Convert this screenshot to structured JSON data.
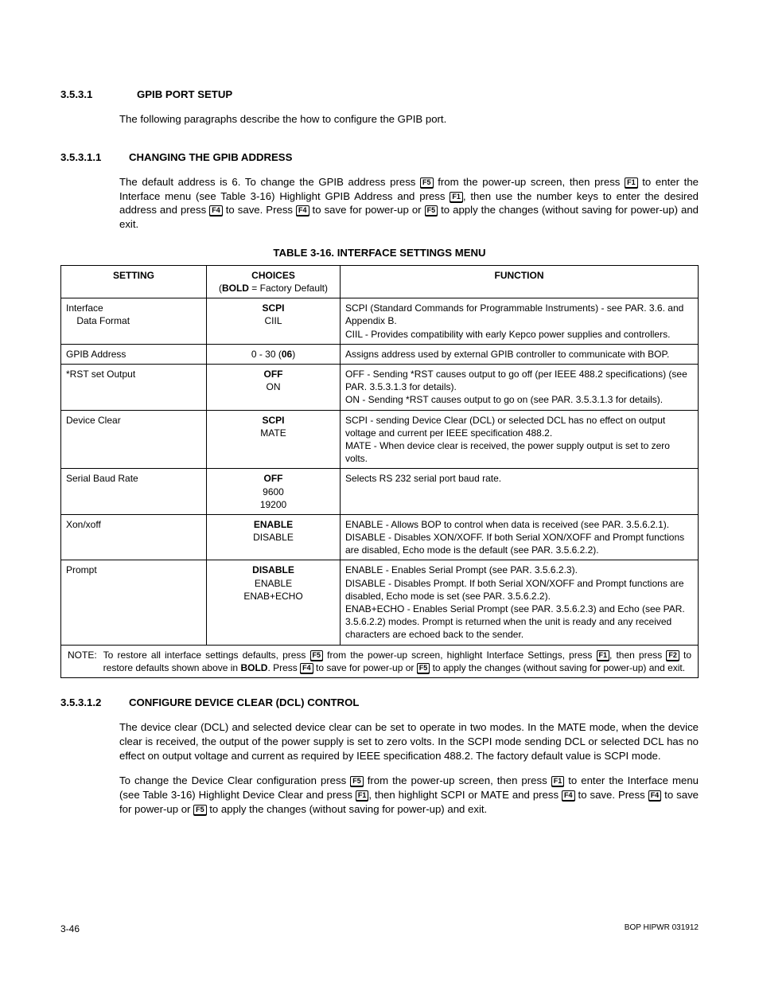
{
  "sections": {
    "s1_num": "3.5.3.1",
    "s1_title": "GPIB PORT SETUP",
    "s1_para": "The following paragraphs describe the how to configure the GPIB port.",
    "s11_num": "3.5.3.1.1",
    "s11_title": "CHANGING THE GPIB ADDRESS",
    "s11_para_a": "The default address is 6. To change the GPIB address press ",
    "s11_para_b": " from the power-up screen, then press ",
    "s11_para_c": " to enter the Interface menu (see Table 3-16) Highlight GPIB Address and press ",
    "s11_para_d": ", then use the number keys to enter the desired address and press ",
    "s11_para_e": " to save. Press ",
    "s11_para_f": " to save for power-up or ",
    "s11_para_g": " to apply the changes (without saving for power-up) and exit.",
    "s12_num": "3.5.3.1.2",
    "s12_title": "CONFIGURE DEVICE CLEAR (DCL) CONTROL",
    "s12_p1": "The device clear (DCL) and selected device clear can be set to operate in two modes. In the MATE mode, when the device clear is received, the output of the power supply is set to zero volts. In the SCPI mode sending DCL or selected DCL has no effect on output voltage and current as required by IEEE specification 488.2. The factory default value is SCPI mode.",
    "s12_p2_a": "To change the Device Clear configuration press ",
    "s12_p2_b": " from the power-up screen, then press ",
    "s12_p2_c": " to enter the Interface menu (see Table 3-16) Highlight Device Clear and press ",
    "s12_p2_d": ", then highlight SCPI or MATE and press ",
    "s12_p2_e": " to save. Press ",
    "s12_p2_f": " to save for power-up or ",
    "s12_p2_g": " to apply the changes (without saving for power-up) and exit."
  },
  "table": {
    "caption": "TABLE 3-16.  INTERFACE SETTINGS MENU",
    "headers": {
      "setting": "SETTING",
      "choices_l1": "CHOICES",
      "choices_l2a": "(",
      "choices_l2b": "BOLD",
      "choices_l2c": " = Factory Default)",
      "function": "FUNCTION"
    },
    "rows": [
      {
        "setting_l1": "Interface",
        "setting_l2": "    Data Format",
        "choices": [
          {
            "t": "SCPI",
            "b": true
          },
          {
            "t": "CIIL",
            "b": false
          }
        ],
        "function": "SCPI (Standard Commands for Programmable Instruments) - see PAR. 3.6. and Appendix B.\nCIIL - Provides compatibility with early Kepco power supplies and controllers."
      },
      {
        "setting_l1": "GPIB Address",
        "choices_inline": {
          "pre": "0 - 30 (",
          "bold": "06",
          "post": ")"
        },
        "function": "Assigns address used by external GPIB controller to communicate with BOP."
      },
      {
        "setting_l1": "*RST set Output",
        "choices": [
          {
            "t": "OFF",
            "b": true
          },
          {
            "t": "ON",
            "b": false
          }
        ],
        "function": "OFF - Sending *RST causes output to go off (per IEEE 488.2 specifications) (see PAR. 3.5.3.1.3 for details).\nON - Sending *RST causes output to go on (see PAR. 3.5.3.1.3 for details)."
      },
      {
        "setting_l1": "Device Clear",
        "choices": [
          {
            "t": "SCPI",
            "b": true
          },
          {
            "t": "MATE",
            "b": false
          }
        ],
        "function": "SCPI - sending Device Clear (DCL) or selected DCL has no effect on output voltage and current per IEEE specification 488.2.\nMATE - When device clear is received, the power supply output is set to zero volts."
      },
      {
        "setting_l1": "Serial Baud Rate",
        "choices": [
          {
            "t": "OFF",
            "b": true
          },
          {
            "t": "9600",
            "b": false
          },
          {
            "t": "19200",
            "b": false
          }
        ],
        "function": "Selects RS 232 serial port baud rate."
      },
      {
        "setting_l1": "Xon/xoff",
        "choices": [
          {
            "t": "ENABLE",
            "b": true
          },
          {
            "t": "DISABLE",
            "b": false
          }
        ],
        "function": "ENABLE - Allows BOP to control when data is received (see PAR. 3.5.6.2.1).\nDISABLE - Disables XON/XOFF. If both Serial XON/XOFF and Prompt functions are disabled, Echo mode is the default (see PAR. 3.5.6.2.2)."
      },
      {
        "setting_l1": "Prompt",
        "choices": [
          {
            "t": "DISABLE",
            "b": true
          },
          {
            "t": "ENABLE",
            "b": false
          },
          {
            "t": "ENAB+ECHO",
            "b": false
          }
        ],
        "function": "ENABLE - Enables Serial Prompt (see PAR. 3.5.6.2.3).\nDISABLE - Disables Prompt. If both Serial XON/XOFF and Prompt functions are disabled, Echo mode is set (see PAR. 3.5.6.2.2).\nENAB+ECHO - Enables Serial Prompt (see PAR. 3.5.6.2.3) and Echo (see PAR. 3.5.6.2.2) modes. Prompt is returned when the unit is ready and any received characters are echoed back to the sender."
      }
    ],
    "note": {
      "label": "NOTE:",
      "a": "To restore all interface settings defaults, press ",
      "b": " from the power-up screen, highlight Interface Settings, press ",
      "c": ", then press ",
      "d": " to restore defaults shown above in ",
      "bold": "BOLD",
      "e": ". Press ",
      "f": " to save for power-up or ",
      "g": " to apply the changes (without saving for power-up) and exit."
    }
  },
  "keys": {
    "F1": "F1",
    "F2": "F2",
    "F4": "F4",
    "F5": "F5"
  },
  "footer": {
    "left": "3-46",
    "right": "BOP HIPWR 031912"
  }
}
